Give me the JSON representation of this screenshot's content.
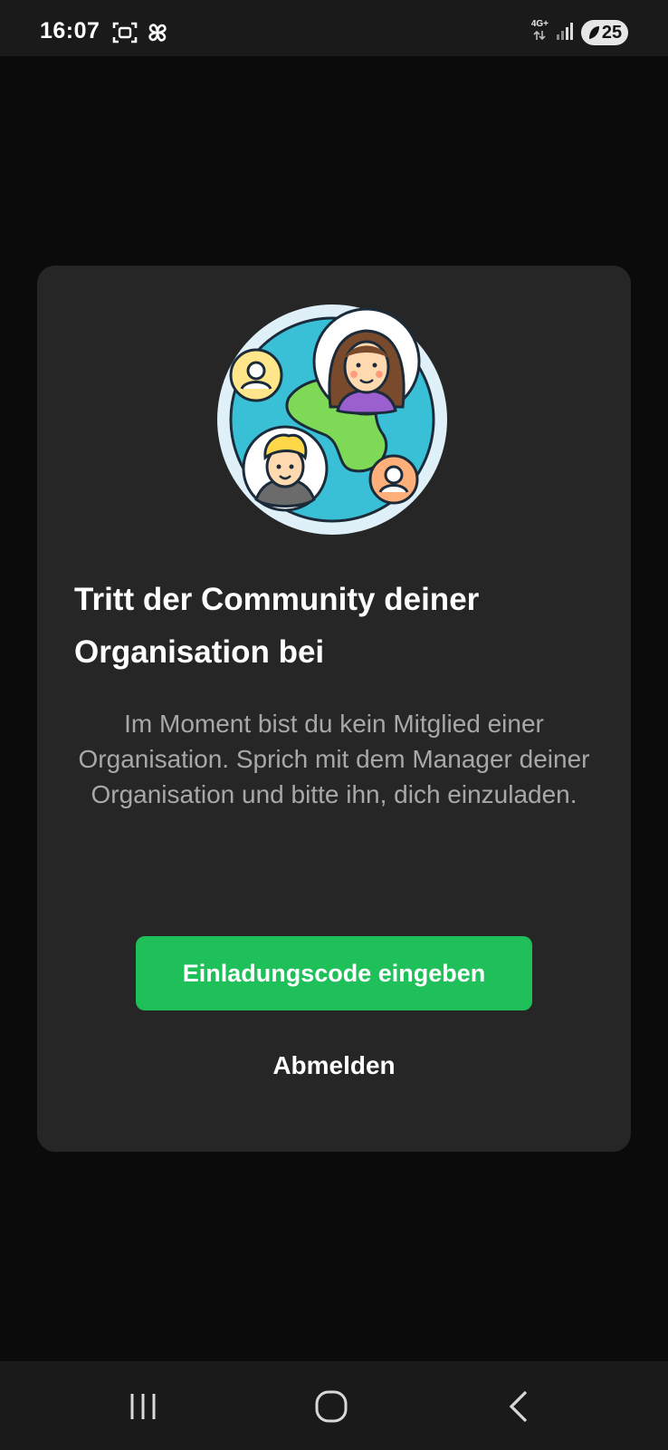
{
  "status_bar": {
    "time": "16:07",
    "network": "4G+",
    "battery": "25",
    "left_icons": [
      "screenshot-icon",
      "pinwheel-icon"
    ],
    "right_icons": [
      "network-arrows-icon",
      "signal-icon",
      "battery-icon"
    ]
  },
  "dialog": {
    "title": "Tritt der Community deiner Organisation bei",
    "body": "Im Moment bist du kein Mitglied einer Organisation. Sprich mit dem Manager deiner Organisation und bitte ihn, dich einzuladen.",
    "primary_button": "Einladungscode eingeben",
    "secondary_button": "Abmelden",
    "illustration": "community-globe-illustration"
  },
  "nav_bar": {
    "items": [
      "recent-apps-icon",
      "home-icon",
      "back-icon"
    ]
  },
  "colors": {
    "background": "#0b0b0b",
    "card": "#262626",
    "accent": "#1fbf5a",
    "body_text": "#a8a8a8",
    "title_text": "#ffffff"
  }
}
